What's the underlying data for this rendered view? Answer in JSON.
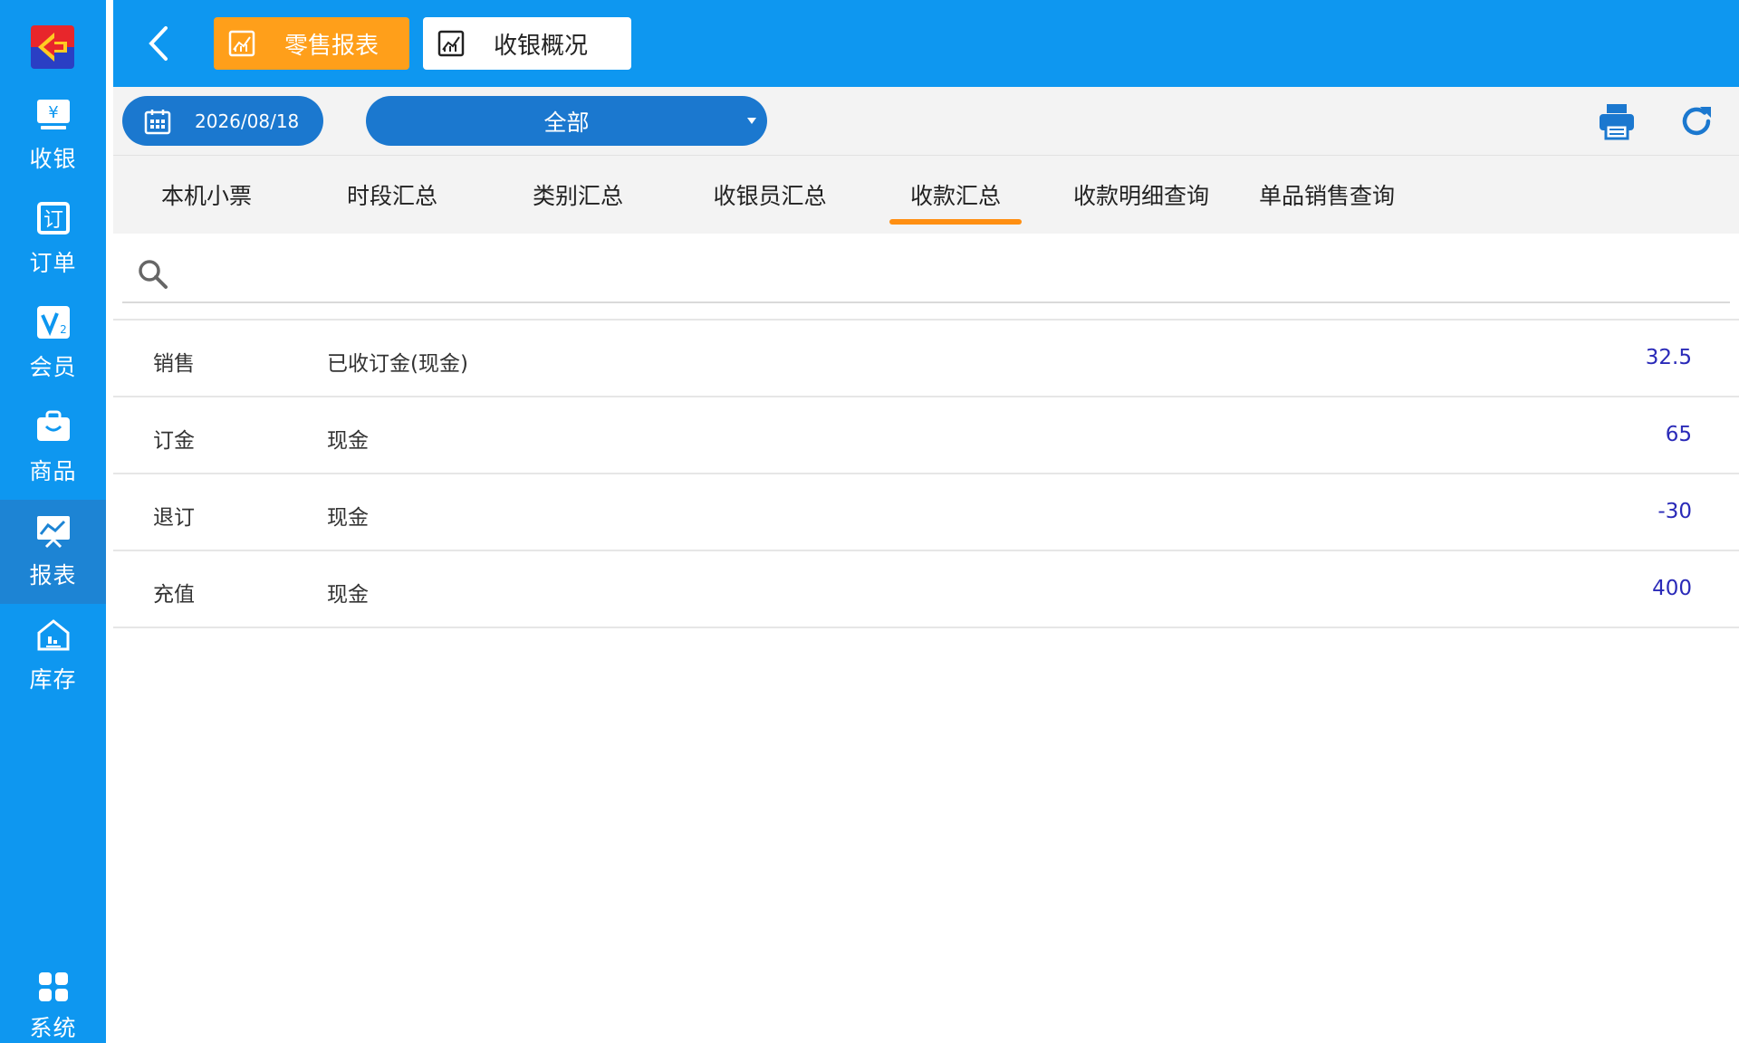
{
  "sidebar": {
    "items": [
      {
        "label": "收银",
        "icon": "cashier-icon"
      },
      {
        "label": "订单",
        "icon": "order-icon"
      },
      {
        "label": "会员",
        "icon": "member-icon"
      },
      {
        "label": "商品",
        "icon": "product-bag-icon"
      },
      {
        "label": "报表",
        "icon": "report-chart-icon"
      },
      {
        "label": "库存",
        "icon": "warehouse-icon"
      }
    ],
    "bottom": {
      "label": "系统",
      "icon": "grid-icon"
    },
    "active": "报表"
  },
  "header": {
    "tabs": [
      {
        "label": "零售报表",
        "icon": "report-icon",
        "active": true
      },
      {
        "label": "收银概况",
        "icon": "report-icon",
        "active": false
      }
    ]
  },
  "toolbar": {
    "date": "2026/08/18",
    "select_value": "全部"
  },
  "categories": [
    "本机小票",
    "时段汇总",
    "类别汇总",
    "收银员汇总",
    "收款汇总",
    "收款明细查询",
    "单品销售查询"
  ],
  "active_category": "收款汇总",
  "search": {
    "placeholder": "",
    "value": ""
  },
  "rows": [
    {
      "type": "销售",
      "method": "已收订金(现金)",
      "amount": "32.5"
    },
    {
      "type": "订金",
      "method": "现金",
      "amount": "65"
    },
    {
      "type": "退订",
      "method": "现金",
      "amount": "-30"
    },
    {
      "type": "充值",
      "method": "现金",
      "amount": "400"
    }
  ],
  "colors": {
    "primary_blue": "#0e97f0",
    "dark_blue": "#1b78cf",
    "orange": "#ff9f1a",
    "amount": "#2a2ab8"
  }
}
